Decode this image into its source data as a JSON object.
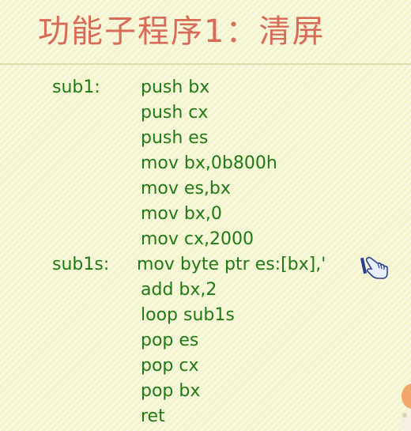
{
  "slide": {
    "title": "功能子程序1：清屏"
  },
  "code": [
    {
      "label": "sub1:",
      "instr": "push bx"
    },
    {
      "label": "",
      "instr": "push cx"
    },
    {
      "label": "",
      "instr": "push es"
    },
    {
      "label": "",
      "instr": "mov bx,0b800h"
    },
    {
      "label": "",
      "instr": "mov es,bx"
    },
    {
      "label": "",
      "instr": "mov bx,0"
    },
    {
      "label": "",
      "instr": "mov cx,2000"
    },
    {
      "label": "sub1s:",
      "instr": "mov byte ptr es:[bx],'"
    },
    {
      "label": "",
      "instr": "add bx,2"
    },
    {
      "label": "",
      "instr": "loop sub1s"
    },
    {
      "label": "",
      "instr": "pop es"
    },
    {
      "label": "",
      "instr": "pop cx"
    },
    {
      "label": "",
      "instr": "pop bx"
    },
    {
      "label": "",
      "instr": "ret"
    }
  ],
  "icons": {
    "pointer": "hand-pointer-icon",
    "corner": "cartoon-character-decoration"
  },
  "colors": {
    "background": "#f3f3cc",
    "title": "#d86a58",
    "code": "#1f7a14"
  }
}
